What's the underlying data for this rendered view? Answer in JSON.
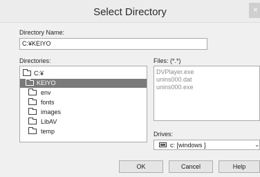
{
  "window": {
    "title": "Select Directory",
    "close_glyph": "×"
  },
  "directory_name": {
    "label": "Directory Name:",
    "value": "C:¥KEIYO"
  },
  "directories": {
    "label": "Directories:",
    "items": [
      {
        "label": "C:¥",
        "icon": "open-folder-icon",
        "selected": false
      },
      {
        "label": "KEIYO",
        "icon": "open-folder-icon",
        "selected": true
      },
      {
        "label": "env",
        "icon": "folder-icon",
        "selected": false
      },
      {
        "label": "fonts",
        "icon": "folder-icon",
        "selected": false
      },
      {
        "label": "images",
        "icon": "folder-icon",
        "selected": false
      },
      {
        "label": "LibAV",
        "icon": "folder-icon",
        "selected": false
      },
      {
        "label": "temp",
        "icon": "folder-icon",
        "selected": false
      }
    ]
  },
  "files": {
    "label": "Files: (*.*)",
    "items": [
      "DVPlayer.exe",
      "unins000.dat",
      "unins000.exe"
    ]
  },
  "drives": {
    "label": "Drives:",
    "value": "c: [windows ]",
    "icon": "drive-icon"
  },
  "buttons": {
    "ok": "OK",
    "cancel": "Cancel",
    "help": "Help"
  },
  "colors": {
    "selection": "#7a7a7a",
    "background": "#f0f0f0"
  }
}
